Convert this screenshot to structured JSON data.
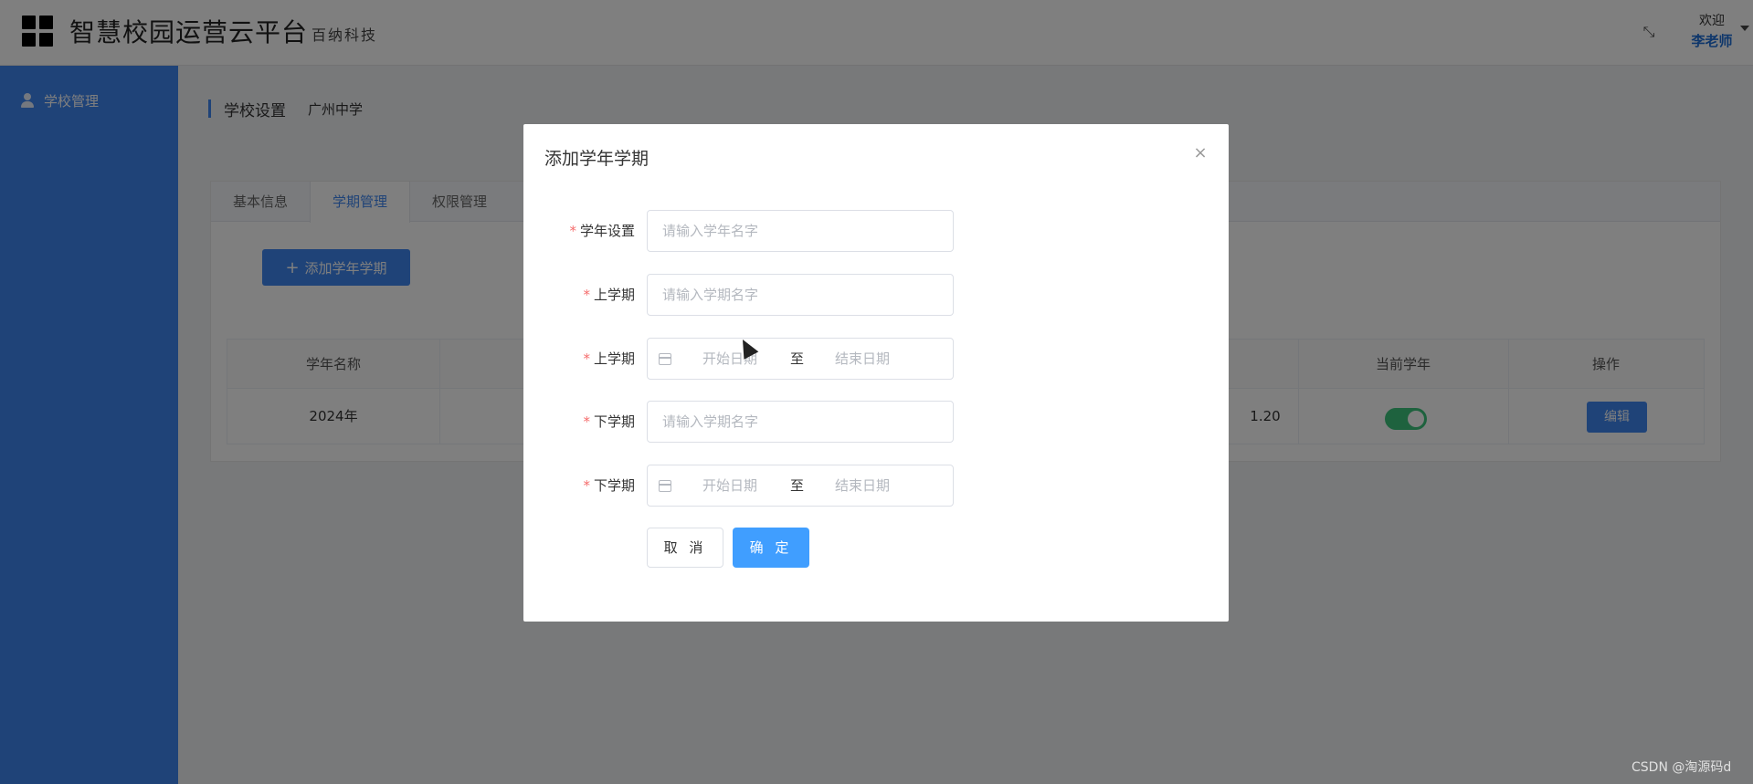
{
  "header": {
    "title": "智慧校园运营云平台",
    "subtitle": "百纳科技",
    "welcome": "欢迎",
    "username": "李老师"
  },
  "sidebar": {
    "items": [
      {
        "label": "学校管理",
        "icon": "user-icon"
      }
    ]
  },
  "breadcrumb": {
    "title": "学校设置",
    "school": "广州中学"
  },
  "tabs": [
    {
      "label": "基本信息",
      "active": false
    },
    {
      "label": "学期管理",
      "active": true
    },
    {
      "label": "权限管理",
      "active": false
    }
  ],
  "main": {
    "add_button_label": "添加学年学期"
  },
  "table": {
    "headers": [
      "学年名称",
      "当前学年",
      "操作"
    ],
    "rows": [
      {
        "name": "2024年",
        "partial_date": "1.20",
        "current": true,
        "action": "编辑"
      }
    ]
  },
  "modal": {
    "title": "添加学年学期",
    "fields": [
      {
        "label": "学年设置",
        "required": true,
        "type": "text",
        "placeholder": "请输入学年名字",
        "value": ""
      },
      {
        "label": "上学期",
        "required": true,
        "type": "text",
        "placeholder": "请输入学期名字",
        "value": ""
      },
      {
        "label": "上学期",
        "required": true,
        "type": "daterange",
        "start_placeholder": "开始日期",
        "separator": "至",
        "end_placeholder": "结束日期"
      },
      {
        "label": "下学期",
        "required": true,
        "type": "text",
        "placeholder": "请输入学期名字",
        "value": ""
      },
      {
        "label": "下学期",
        "required": true,
        "type": "daterange",
        "start_placeholder": "开始日期",
        "separator": "至",
        "end_placeholder": "结束日期"
      }
    ],
    "cancel_label": "取 消",
    "ok_label": "确 定"
  },
  "watermark": "CSDN @淘源码d",
  "colors": {
    "primary": "#3e86f0",
    "button_primary": "#409eff",
    "required": "#f56c6c",
    "switch_on": "#3cc47c"
  }
}
